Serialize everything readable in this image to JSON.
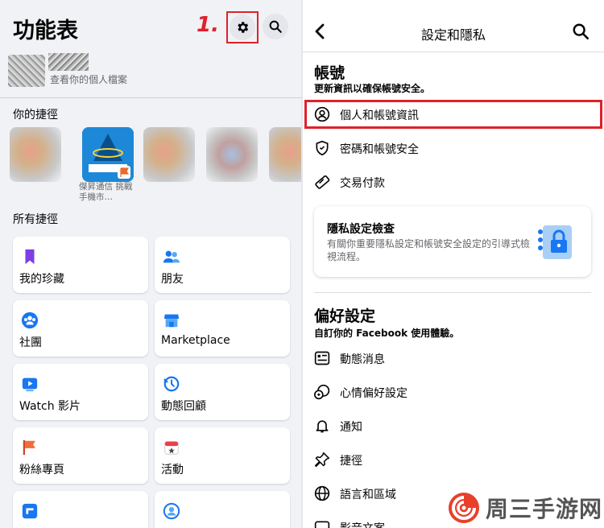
{
  "left_panel": {
    "title": "功能表",
    "step_marker": "1.",
    "profile": {
      "subtitle": "查看你的個人檔案"
    },
    "shortcuts_label": "你的捷徑",
    "shortcut_app_name": "傑昇通信 挑戰手機市…",
    "all_shortcuts_label": "所有捷徑",
    "grid": [
      {
        "label": "我的珍藏",
        "icon": "bookmark-icon"
      },
      {
        "label": "朋友",
        "icon": "friends-icon"
      },
      {
        "label": "社團",
        "icon": "groups-icon"
      },
      {
        "label": "Marketplace",
        "icon": "marketplace-icon"
      },
      {
        "label": "Watch 影片",
        "icon": "watch-icon"
      },
      {
        "label": "動態回顧",
        "icon": "memories-icon"
      },
      {
        "label": "粉絲專頁",
        "icon": "pages-flag-icon"
      },
      {
        "label": "活動",
        "icon": "events-icon"
      },
      {
        "label": "",
        "icon": "gaming-icon"
      },
      {
        "label": "",
        "icon": "profile-circle-icon"
      }
    ]
  },
  "right_panel": {
    "header_title": "設定和隱私",
    "account": {
      "title": "帳號",
      "description": "更新資訊以確保帳號安全。",
      "items": [
        {
          "label": "個人和帳號資訊",
          "icon": "person-circle-icon"
        },
        {
          "label": "密碼和帳號安全",
          "icon": "shield-icon"
        },
        {
          "label": "交易付款",
          "icon": "tag-icon"
        }
      ]
    },
    "privacy_checkup": {
      "title": "隱私設定檢查",
      "description": "有關你重要隱私設定和帳號安全設定的引導式檢視流程。"
    },
    "preferences": {
      "title": "偏好設定",
      "description": "自訂你的 Facebook 使用體驗。",
      "items": [
        {
          "label": "動態消息",
          "icon": "news-feed-icon"
        },
        {
          "label": "心情偏好設定",
          "icon": "reactions-icon"
        },
        {
          "label": "通知",
          "icon": "bell-icon"
        },
        {
          "label": "捷徑",
          "icon": "pin-icon"
        },
        {
          "label": "語言和區域",
          "icon": "globe-icon"
        },
        {
          "label": "影音文案",
          "icon": "media-icon"
        }
      ]
    }
  },
  "watermark": {
    "text": "周三手游网"
  },
  "colors": {
    "highlight": "#e0202a",
    "fb_blue": "#1877f2"
  }
}
